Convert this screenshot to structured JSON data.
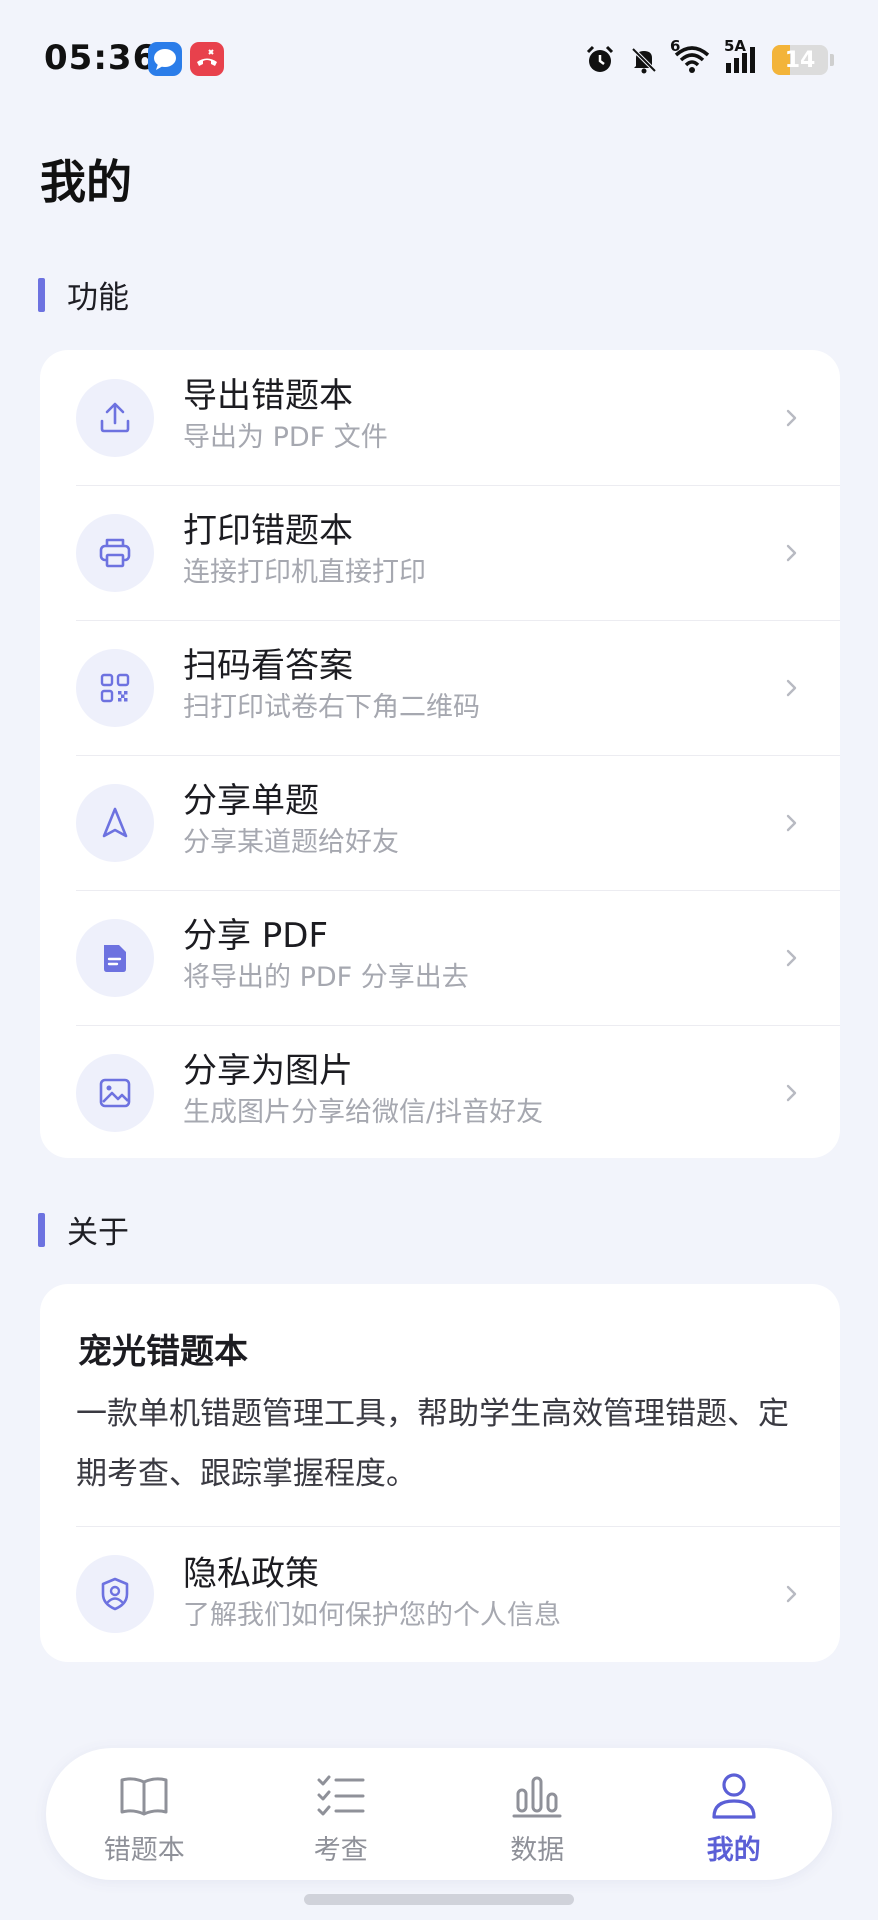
{
  "status_bar": {
    "time": "05:36",
    "battery": "14",
    "network": "5A",
    "wifi_badge": "6",
    "icons": [
      "message-app-icon",
      "call-app-icon",
      "alarm-icon",
      "bell-muted-icon",
      "wifi-icon",
      "cellular-signal-icon",
      "battery-icon"
    ]
  },
  "page_title": "我的",
  "functions": {
    "section_label": "功能",
    "items": [
      {
        "title": "导出错题本",
        "subtitle": "导出为 PDF 文件",
        "icon": "upload-icon"
      },
      {
        "title": "打印错题本",
        "subtitle": "连接打印机直接打印",
        "icon": "printer-icon"
      },
      {
        "title": "扫码看答案",
        "subtitle": "扫打印试卷右下角二维码",
        "icon": "qr-code-icon"
      },
      {
        "title": "分享单题",
        "subtitle": "分享某道题给好友",
        "icon": "send-icon"
      },
      {
        "title": "分享 PDF",
        "subtitle": "将导出的 PDF 分享出去",
        "icon": "document-icon"
      },
      {
        "title": "分享为图片",
        "subtitle": "生成图片分享给微信/抖音好友",
        "icon": "image-icon"
      }
    ]
  },
  "about": {
    "section_label": "关于",
    "app_name": "宠光错题本",
    "description": "一款单机错题管理工具，帮助学生高效管理错题、定期考查、跟踪掌握程度。",
    "privacy": {
      "title": "隐私政策",
      "subtitle": "了解我们如何保护您的个人信息",
      "icon": "shield-user-icon"
    }
  },
  "bottom_nav": {
    "items": [
      {
        "label": "错题本",
        "icon": "book-icon",
        "active": false
      },
      {
        "label": "考查",
        "icon": "checklist-icon",
        "active": false
      },
      {
        "label": "数据",
        "icon": "bar-chart-icon",
        "active": false
      },
      {
        "label": "我的",
        "icon": "user-icon",
        "active": true
      }
    ]
  },
  "colors": {
    "accent": "#5b5fd6",
    "background": "#f2f4fb",
    "card": "#ffffff",
    "icon_bg": "#eef0fb",
    "muted_text": "#a6a8b0"
  }
}
